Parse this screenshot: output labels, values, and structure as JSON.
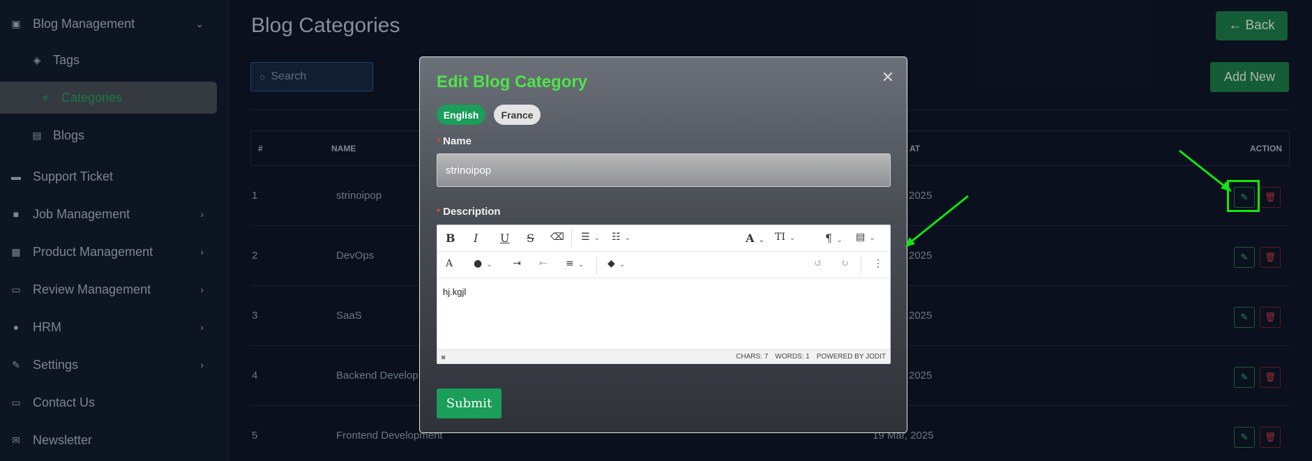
{
  "sidebar": {
    "items": [
      {
        "label": "Blog Management",
        "icon": "blog-icon"
      },
      {
        "label": "Tags",
        "icon": "tags-icon"
      },
      {
        "label": "Categories",
        "icon": "hash-icon"
      },
      {
        "label": "Blogs",
        "icon": "blogs-icon"
      },
      {
        "label": "Support Ticket",
        "icon": "ticket-icon"
      },
      {
        "label": "Job Management",
        "icon": "briefcase-icon"
      },
      {
        "label": "Product Management",
        "icon": "grid-icon"
      },
      {
        "label": "Review Management",
        "icon": "review-icon"
      },
      {
        "label": "HRM",
        "icon": "users-icon"
      },
      {
        "label": "Settings",
        "icon": "wrench-icon"
      },
      {
        "label": "Contact Us",
        "icon": "contact-icon"
      },
      {
        "label": "Newsletter",
        "icon": "mail-icon"
      }
    ]
  },
  "header": {
    "title": "Blog Categories",
    "back_label": "← Back"
  },
  "search": {
    "placeholder": "Search"
  },
  "toolbar": {
    "add_label": "Add New"
  },
  "table": {
    "columns": [
      "#",
      "NAME",
      "AT",
      "ACTION"
    ],
    "rows": [
      {
        "num": "1",
        "name": "strinoipop",
        "date": "2025"
      },
      {
        "num": "2",
        "name": "DevOps",
        "date": "2025"
      },
      {
        "num": "3",
        "name": "SaaS",
        "date": "2025"
      },
      {
        "num": "4",
        "name": "Backend Develop",
        "date": "2025"
      },
      {
        "num": "5",
        "name": "Frontend Development",
        "date": "19 Mar, 2025"
      }
    ]
  },
  "modal": {
    "title": "Edit Blog Category",
    "languages": [
      "English",
      "France"
    ],
    "name_label": "Name",
    "name_value": "strinoipop",
    "description_label": "Description",
    "description_value": "hj.kgjl",
    "footer": {
      "chars": "CHARS: 7",
      "words": "WORDS: 1",
      "powered": "POWERED BY JODIT"
    },
    "submit_label": "Submit"
  },
  "colors": {
    "accent": "#1a9e5a",
    "title_green": "#4ee44a",
    "annotation": "#11e611",
    "delete": "#b0323c"
  }
}
